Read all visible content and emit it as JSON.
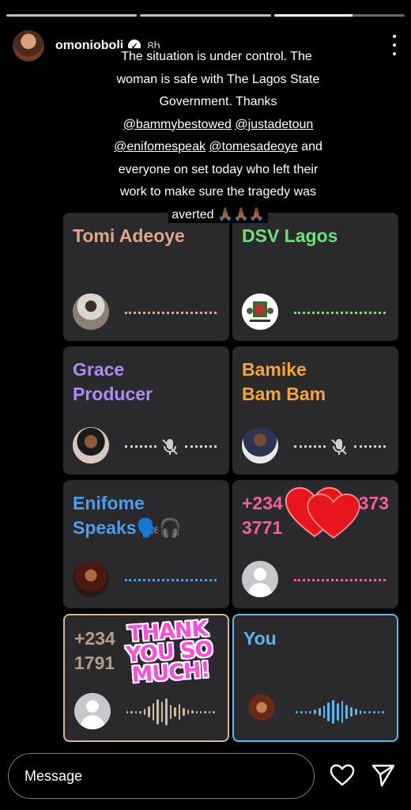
{
  "story": {
    "progress_segments": 3,
    "active_segment": 3,
    "username": "omonioboli",
    "time": "8h",
    "caption": {
      "line1": "The situation is under control. The",
      "line2": "woman is safe with The Lagos State",
      "line3": "Government. Thanks",
      "mention1": "@bammybestowed",
      "mention2": "@justadetoun",
      "mention3": "@enifomespeak",
      "mention4": "@tomesadeoye",
      "after_mentions": "and",
      "line6": "everyone on set today who left their",
      "line7": "work to make sure the tragedy was",
      "line8_text": "averted",
      "line8_emoji": "🙏🏾🙏🏾🙏🏾"
    }
  },
  "call": {
    "tiles": [
      {
        "name_line1": "Tomi  Adeoye",
        "name_line2": "",
        "color": "#e0a58a",
        "avatar": "photo",
        "state": "speaking-dots"
      },
      {
        "name_line1": "DSV Lagos",
        "name_line2": "",
        "color": "#6ee07a",
        "avatar": "logo",
        "state": "speaking-dots"
      },
      {
        "name_line1": "Grace",
        "name_line2": "Producer",
        "color": "#b08cf0",
        "avatar": "photo",
        "state": "muted"
      },
      {
        "name_line1": "Bamike",
        "name_line2": "Bam Bam",
        "color": "#f2a63a",
        "avatar": "photo",
        "state": "muted"
      },
      {
        "name_line1": "Enifome",
        "name_line2": "Speaks🗣️🎧",
        "color": "#4c9df0",
        "avatar": "photo",
        "state": "speaking-dots"
      },
      {
        "name_line1": "+234",
        "name_line1_end": "373",
        "name_line2": "3771",
        "color": "#f0609a",
        "avatar": "generic",
        "state": "speaking-dots"
      },
      {
        "name_line1": "+234",
        "name_line2": "1791",
        "color": "#b59e86",
        "avatar": "generic",
        "state": "waveform"
      },
      {
        "name_line1": "You",
        "name_line2": "",
        "color": "#58b8ea",
        "avatar": "photo",
        "state": "waveform"
      }
    ]
  },
  "sticker": {
    "line1": "THANK",
    "line2": "YOU SO",
    "line3": "MUCH!"
  },
  "reply": {
    "placeholder": "Message"
  },
  "icons": {
    "like": "heart-icon",
    "share": "send-icon",
    "menu": "more-icon"
  }
}
